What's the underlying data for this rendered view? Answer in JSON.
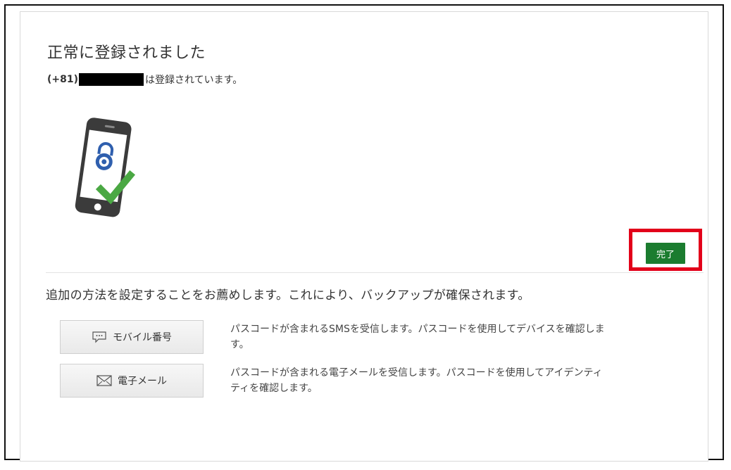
{
  "header": {
    "title": "正常に登録されました",
    "country_code": "(+81)",
    "registered_suffix": "は登録されています。"
  },
  "actions": {
    "done_label": "完了"
  },
  "recommendation": {
    "text": "追加の方法を設定することをお薦めします。これにより、バックアップが確保されます。"
  },
  "methods": [
    {
      "label": "モバイル番号",
      "icon": "chat-bubble-icon",
      "description": "パスコードが含まれるSMSを受信します。パスコードを使用してデバイスを確認しま\nす。"
    },
    {
      "label": "電子メール",
      "icon": "envelope-icon",
      "description": "パスコードが含まれる電子メールを受信します。パスコードを使用してアイデンティ\nティを確認します。"
    }
  ],
  "colors": {
    "primary_button": "#1b7c2f",
    "highlight_border": "#e2001a",
    "lock_blue": "#2f5fae",
    "check_green": "#4aa843"
  }
}
